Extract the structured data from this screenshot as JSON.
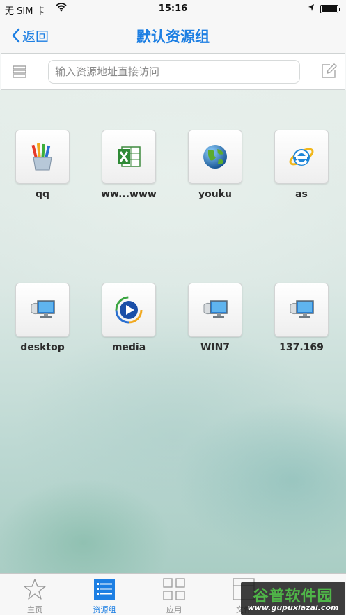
{
  "status_bar": {
    "carrier": "无 SIM 卡",
    "time": "15:16",
    "battery_level": 1.0
  },
  "nav": {
    "back_label": "返回",
    "title": "默认资源组"
  },
  "search": {
    "placeholder": "输入资源地址直接访问"
  },
  "resources": [
    {
      "label": "qq",
      "icon": "paint-brushes-icon"
    },
    {
      "label": "ww...www",
      "icon": "excel-icon"
    },
    {
      "label": "youku",
      "icon": "globe-icon"
    },
    {
      "label": "as",
      "icon": "internet-explorer-icon"
    },
    {
      "label": "desktop",
      "icon": "remote-desktop-icon"
    },
    {
      "label": "media",
      "icon": "media-player-icon"
    },
    {
      "label": "WIN7",
      "icon": "remote-desktop-icon"
    },
    {
      "label": "137.169",
      "icon": "remote-desktop-icon"
    }
  ],
  "tabs": [
    {
      "label": "主页",
      "icon": "star-icon",
      "active": false
    },
    {
      "label": "资源组",
      "icon": "list-icon",
      "active": true
    },
    {
      "label": "应用",
      "icon": "grid-icon",
      "active": false
    },
    {
      "label": "文件",
      "icon": "file-icon",
      "active": false
    }
  ],
  "watermark": {
    "text": "谷普软件园",
    "url": "www.gupuxiazai.com"
  },
  "colors": {
    "accent": "#1d7fe3",
    "watermark_green": "#4fb548"
  }
}
